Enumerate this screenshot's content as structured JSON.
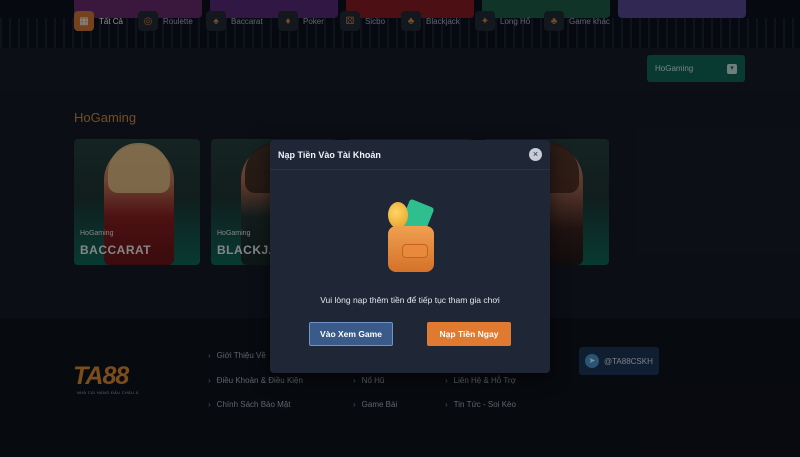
{
  "categories": [
    {
      "label": "Tất Cả",
      "icon": "all-games-icon",
      "active": true
    },
    {
      "label": "Roulette",
      "icon": "roulette-icon",
      "active": false
    },
    {
      "label": "Baccarat",
      "icon": "baccarat-icon",
      "active": false
    },
    {
      "label": "Poker",
      "icon": "poker-icon",
      "active": false
    },
    {
      "label": "Sicbo",
      "icon": "sicbo-icon",
      "active": false
    },
    {
      "label": "Blackjack",
      "icon": "blackjack-icon",
      "active": false
    },
    {
      "label": "Long Hổ",
      "icon": "dragon-tiger-icon",
      "active": false
    },
    {
      "label": "Game khác",
      "icon": "other-games-icon",
      "active": false
    }
  ],
  "provider_select": {
    "value": "HoGaming"
  },
  "section": {
    "title": "HoGaming"
  },
  "cards": [
    {
      "brand": "HoGaming",
      "name": "BACCARAT"
    },
    {
      "brand": "HoGaming",
      "name": "BLACKJAC"
    }
  ],
  "footer": {
    "logo": "TA88",
    "tagline": "NHÀ CÁI HÀNG ĐẦU CHÂU Á",
    "links": [
      "Giới Thiệu Về",
      "Điều Khoản & Điều Kiện",
      "Chính Sách Bảo Mật",
      "Nổ Hũ",
      "Game Bài",
      "Liên Hệ & Hỗ Trợ",
      "Tin Tức - Soi Kèo"
    ],
    "telegram": "@TA88CSKH"
  },
  "modal": {
    "title": "Nạp Tiền Vào Tài Khoản",
    "message": "Vui lòng nạp thêm tiền để tiếp tục tham gia chơi",
    "view_game_label": "Vào Xem Game",
    "deposit_label": "Nạp Tiền Ngay"
  },
  "colors": {
    "accent": "#e07a30",
    "provider": "#0f6a5c",
    "modal_bg": "#1f2736",
    "page_bg": "#151b27"
  }
}
